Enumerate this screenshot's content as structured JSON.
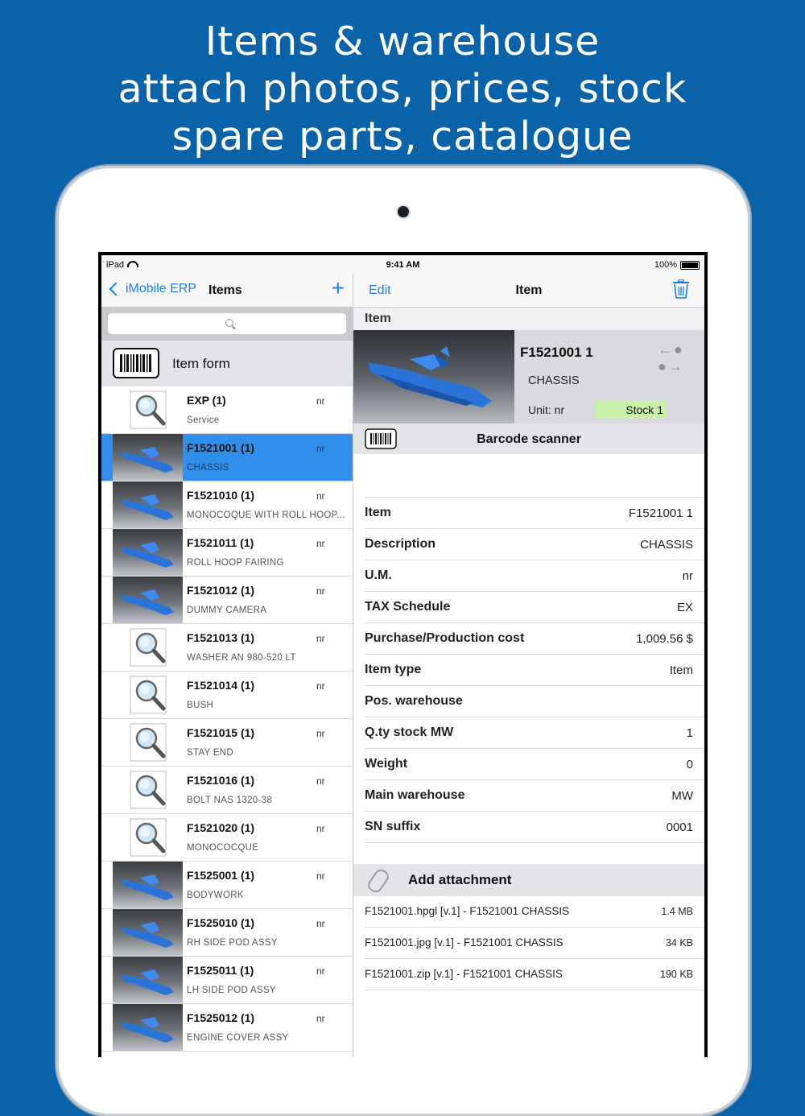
{
  "headline": [
    "Items & warehouse",
    "attach photos, prices, stock",
    "spare parts, catalogue"
  ],
  "status": {
    "carrier": "iPad",
    "time": "9:41 AM",
    "battery": "100%"
  },
  "left": {
    "back_label": "iMobile ERP",
    "title": "Items",
    "add_label": "+",
    "item_form_label": "Item form",
    "rows": [
      {
        "code": "EXP (1)",
        "unit": "nr",
        "desc": "Service",
        "thumb": "magnifier",
        "selected": false
      },
      {
        "code": "F1521001 (1)",
        "unit": "nr",
        "desc": "CHASSIS",
        "thumb": "photo",
        "selected": true
      },
      {
        "code": "F1521010 (1)",
        "unit": "nr",
        "desc": "MONOCOQUE WITH ROLL HOOP...",
        "thumb": "photo",
        "selected": false
      },
      {
        "code": "F1521011 (1)",
        "unit": "nr",
        "desc": "ROLL HOOP FAIRING",
        "thumb": "photo",
        "selected": false
      },
      {
        "code": "F1521012 (1)",
        "unit": "nr",
        "desc": "DUMMY CAMERA",
        "thumb": "photo",
        "selected": false
      },
      {
        "code": "F1521013 (1)",
        "unit": "nr",
        "desc": "WASHER AN 980-520 LT",
        "thumb": "magnifier",
        "selected": false
      },
      {
        "code": "F1521014 (1)",
        "unit": "nr",
        "desc": "BUSH",
        "thumb": "magnifier",
        "selected": false
      },
      {
        "code": "F1521015 (1)",
        "unit": "nr",
        "desc": "STAY END",
        "thumb": "magnifier",
        "selected": false
      },
      {
        "code": "F1521016 (1)",
        "unit": "nr",
        "desc": "BOLT NAS 1320-38",
        "thumb": "magnifier",
        "selected": false
      },
      {
        "code": "F1521020 (1)",
        "unit": "nr",
        "desc": "MONOCOCQUE",
        "thumb": "magnifier",
        "selected": false
      },
      {
        "code": "F1525001 (1)",
        "unit": "nr",
        "desc": "BODYWORK",
        "thumb": "photo",
        "selected": false
      },
      {
        "code": "F1525010 (1)",
        "unit": "nr",
        "desc": "RH SIDE POD ASSY",
        "thumb": "photo",
        "selected": false
      },
      {
        "code": "F1525011 (1)",
        "unit": "nr",
        "desc": "LH SIDE POD ASSY",
        "thumb": "photo",
        "selected": false
      },
      {
        "code": "F1525012 (1)",
        "unit": "nr",
        "desc": "ENGINE COVER ASSY",
        "thumb": "photo",
        "selected": false
      }
    ]
  },
  "right": {
    "edit_label": "Edit",
    "title": "Item",
    "section_label": "Item",
    "summary": {
      "code": "F1521001 1",
      "name": "CHASSIS",
      "unit": "Unit: nr",
      "stock": "Stock 1",
      "stock_color": "#c8f0a8"
    },
    "barcode_label": "Barcode scanner",
    "fields": [
      {
        "k": "Item",
        "v": "F1521001 1"
      },
      {
        "k": "Description",
        "v": "CHASSIS"
      },
      {
        "k": "U.M.",
        "v": "nr"
      },
      {
        "k": "TAX Schedule",
        "v": "EX"
      },
      {
        "k": "Purchase/Production cost",
        "v": "1,009.56 $"
      },
      {
        "k": "Item type",
        "v": "Item"
      },
      {
        "k": "Pos. warehouse",
        "v": ""
      },
      {
        "k": "Q.ty stock MW",
        "v": "1"
      },
      {
        "k": "Weight",
        "v": "0"
      },
      {
        "k": "Main warehouse",
        "v": "MW"
      },
      {
        "k": "SN suffix",
        "v": "0001"
      }
    ],
    "attach_label": "Add attachment",
    "attachments": [
      {
        "name": "F1521001.hpgl [v.1] - F1521001 CHASSIS",
        "size": "1.4 MB"
      },
      {
        "name": "F1521001.jpg [v.1] - F1521001 CHASSIS",
        "size": "34 KB"
      },
      {
        "name": "F1521001.zip [v.1] - F1521001 CHASSIS",
        "size": "190 KB"
      }
    ]
  },
  "colors": {
    "background": "#0a62a8",
    "accent": "#147efb",
    "selection": "#2f8fea",
    "part_blue": "#2a73d9"
  }
}
